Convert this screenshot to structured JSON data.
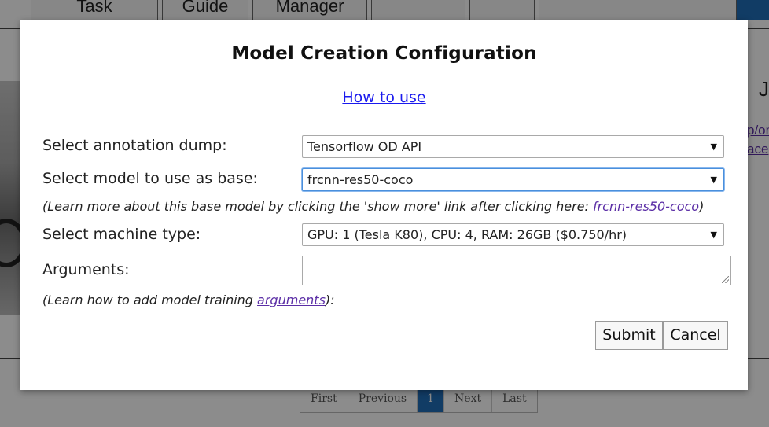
{
  "background": {
    "tabs": [
      "Task",
      "Guide",
      "Manager",
      "",
      "",
      ""
    ],
    "right_heading": "J",
    "right_links": [
      "p/on",
      "ace"
    ],
    "pagination": {
      "buttons": [
        "First",
        "Previous",
        "1",
        "Next",
        "Last"
      ],
      "active": "1"
    },
    "accent_color": "#1f6db8"
  },
  "modal": {
    "title": "Model Creation Configuration",
    "help_link": "How to use",
    "annotation_dump": {
      "label": "Select annotation dump:",
      "value": "Tensorflow OD API"
    },
    "base_model": {
      "label": "Select model to use as base:",
      "value": "frcnn-res50-coco",
      "note_prefix": "(Learn more about this base model by clicking the 'show more' link after clicking here: ",
      "note_link": "frcnn-res50-coco",
      "note_suffix": ")"
    },
    "machine_type": {
      "label": "Select machine type:",
      "value": "GPU: 1 (Tesla K80), CPU: 4, RAM: 26GB ($0.750/hr)"
    },
    "arguments": {
      "label": "Arguments:",
      "value": "",
      "note_prefix": "(Learn how to add model training ",
      "note_link": "arguments",
      "note_suffix": "):"
    },
    "submit_label": "Submit",
    "cancel_label": "Cancel",
    "caret_icon": "chevron-down-icon"
  }
}
